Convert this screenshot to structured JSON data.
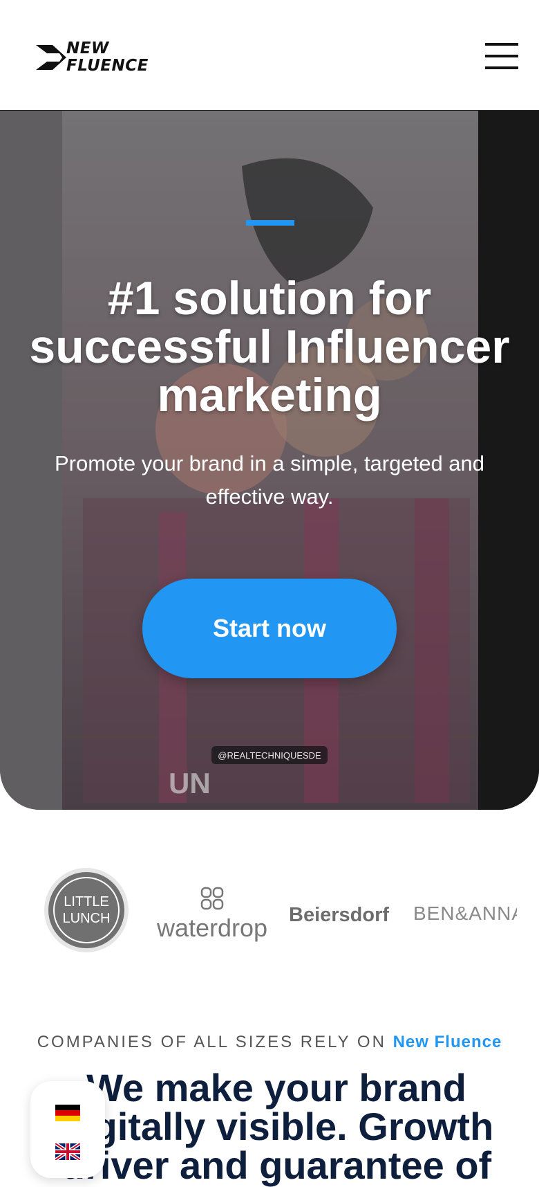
{
  "header": {
    "logo_line1": "NEW",
    "logo_line2": "FLUENCE",
    "menu_icon": "hamburger-menu-icon"
  },
  "hero": {
    "title": "#1 solution for successful Influencer marketing",
    "subtitle": "Promote your brand in a simple, targeted and effective way.",
    "cta_label": "Start now",
    "watermark_text": "@REALTECHNIQUESDE",
    "bg_text": "UN",
    "accent_color": "#2196f3"
  },
  "brands": {
    "little_lunch": "LITTLE LUNCH",
    "waterdrop": "waterdrop",
    "beiersdorf": "Beiersdorf",
    "ben_anna": "BEN&ANNA"
  },
  "trust": {
    "kicker_prefix": "COMPANIES OF ALL SIZES RELY ON",
    "kicker_brand": "New Fluence",
    "headline": "We make your brand digitally visible. Growth driver and guarantee of"
  },
  "language": {
    "options": [
      "de-flag-icon",
      "uk-flag-icon"
    ]
  },
  "colors": {
    "accent": "#2196f3",
    "headline": "#0d1f3c"
  }
}
